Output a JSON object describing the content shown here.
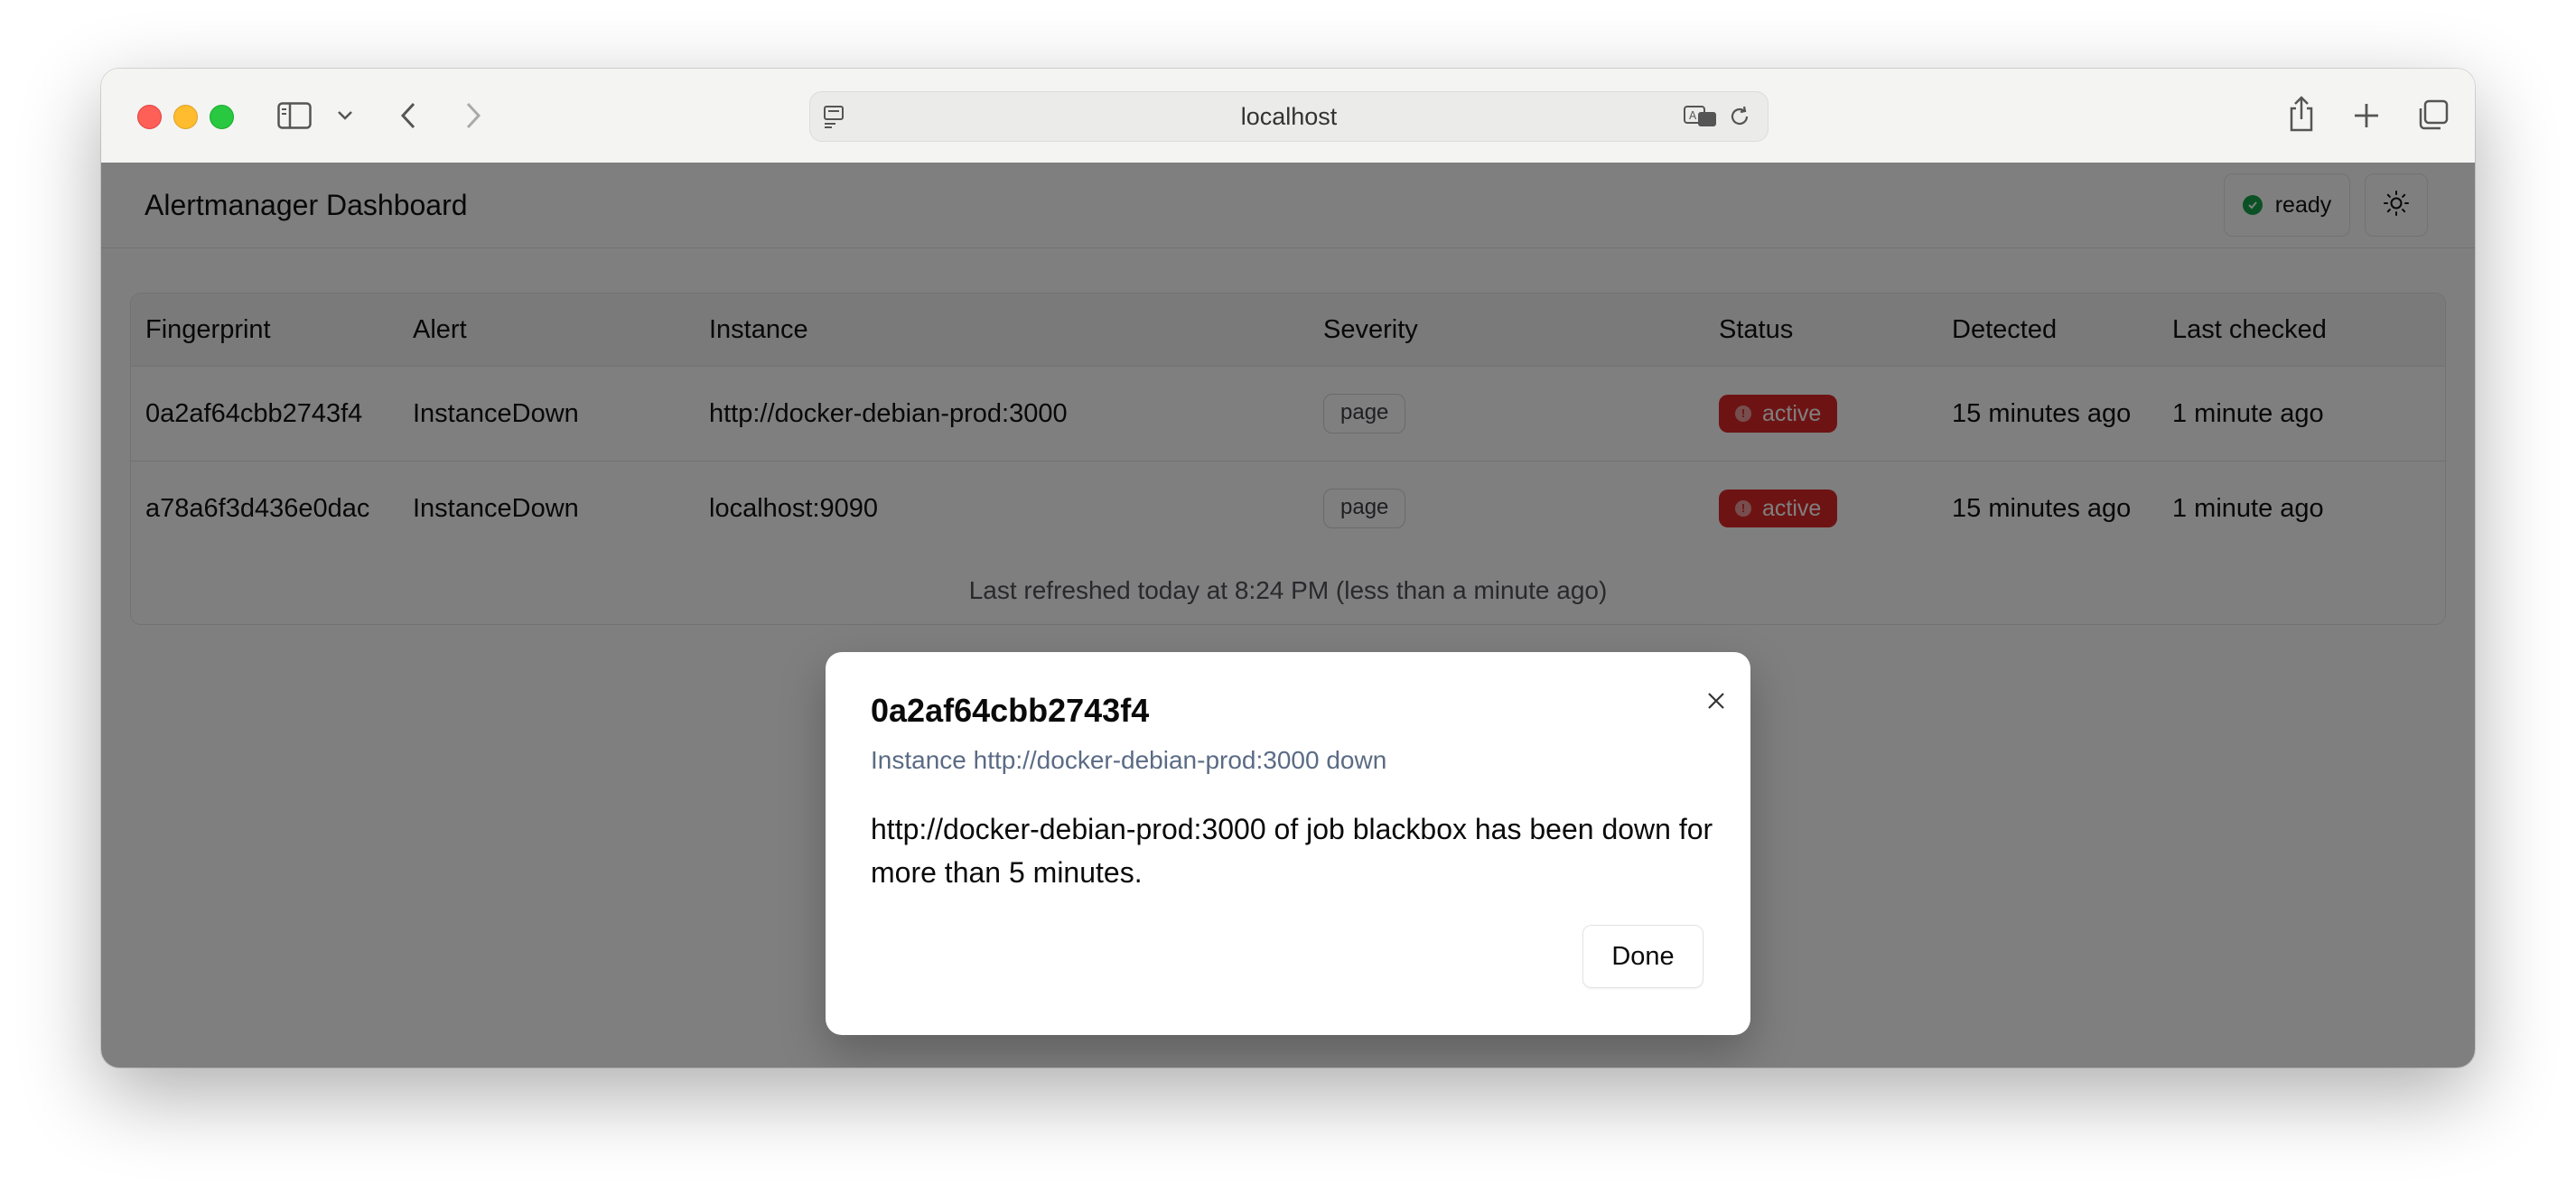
{
  "browser": {
    "url": "localhost",
    "icons": [
      "sidebar-icon",
      "chevron-down-icon",
      "back-icon",
      "forward-icon",
      "page-menu-icon",
      "translate-icon",
      "reload-icon",
      "share-icon",
      "new-tab-icon",
      "tabs-overview-icon"
    ]
  },
  "header": {
    "title": "Alertmanager Dashboard",
    "status_label": "ready",
    "status_color": "#16a34a",
    "theme_icon": "sun-icon"
  },
  "table": {
    "columns": [
      "Fingerprint",
      "Alert",
      "Instance",
      "Severity",
      "Status",
      "Detected",
      "Last checked"
    ],
    "rows": [
      {
        "fingerprint": "0a2af64cbb2743f4",
        "alert": "InstanceDown",
        "instance": "http://docker-debian-prod:3000",
        "severity": "page",
        "status": "active",
        "detected": "15 minutes ago",
        "last_checked": "1 minute ago"
      },
      {
        "fingerprint": "a78a6f3d436e0dac",
        "alert": "InstanceDown",
        "instance": "localhost:9090",
        "severity": "page",
        "status": "active",
        "detected": "15 minutes ago",
        "last_checked": "1 minute ago"
      }
    ],
    "status_color": "#dc2626",
    "last_refreshed": "Last refreshed today at 8:24 PM (less than a minute ago)"
  },
  "modal": {
    "title": "0a2af64cbb2743f4",
    "subtitle": "Instance http://docker-debian-prod:3000 down",
    "description": "http://docker-debian-prod:3000 of job blackbox has been down for more than 5 minutes.",
    "done_label": "Done",
    "close_icon": "close-icon"
  }
}
